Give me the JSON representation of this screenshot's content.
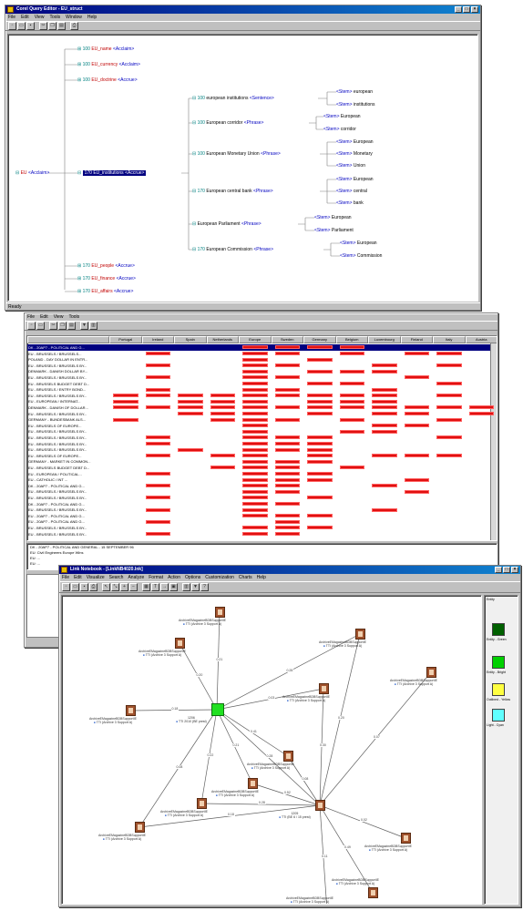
{
  "win1": {
    "title": "Corel Query Editor - EU_struct",
    "menu": [
      "File",
      "Edit",
      "View",
      "Tools",
      "Window",
      "Help"
    ],
    "status": "Ready",
    "tree": {
      "root": {
        "prefix": "EU",
        "tag": "<Acclaim>"
      },
      "top": [
        {
          "num": "100",
          "name": "EU_name",
          "tag": "<Acclaim>"
        },
        {
          "num": "100",
          "name": "EU_currency",
          "tag": "<Acclaim>"
        },
        {
          "num": "100",
          "name": "EU_doctrine",
          "tag": "<Accrue>"
        }
      ],
      "selected": {
        "num": "170",
        "name": "EU_institutions",
        "tag": "<Accrue>"
      },
      "bottom": [
        {
          "num": "170",
          "name": "EU_people",
          "tag": "<Accrue>"
        },
        {
          "num": "170",
          "name": "EU_finance",
          "tag": "<Accrue>"
        },
        {
          "num": "170",
          "name": "EU_affairs",
          "tag": "<Accrue>"
        }
      ],
      "groups": [
        {
          "num": "100",
          "text": "european institutions",
          "tag": "<Sentence>",
          "leaves": [
            "european",
            "institutions"
          ]
        },
        {
          "num": "100",
          "text": "European corridor",
          "tag": "<Phrase>",
          "leaves": [
            "European",
            "corridor"
          ]
        },
        {
          "num": "100",
          "text": "European Monetary Union",
          "tag": "<Phrase>",
          "leaves": [
            "European",
            "Monetary",
            "Union"
          ]
        },
        {
          "num": "170",
          "text": "European central bank",
          "tag": "<Phrase>",
          "leaves": [
            "European",
            "central",
            "bank"
          ]
        },
        {
          "num": "",
          "text": "European Parliament",
          "tag": "<Phrase>",
          "leaves": [
            "European",
            "Parliament"
          ]
        },
        {
          "num": "170",
          "text": "European Commission",
          "tag": "<Phrase>",
          "leaves": [
            "European",
            "Commission"
          ]
        }
      ],
      "leaf_tag": "<Stem>"
    }
  },
  "win2": {
    "menu": [
      "File",
      "Edit",
      "View",
      "Tools"
    ],
    "columns": [
      "Portugal",
      "Ireland",
      "Spain",
      "Netherlands",
      "Europe",
      "Sweden",
      "Germany",
      "Belgium",
      "Luxembourg",
      "Finland",
      "Italy",
      "Austria"
    ],
    "rows": [
      "DK - 20AP7 - POLITICAL AND G...",
      "EU - BRUSSELS / BRUSSELS...",
      "POLAND - DAY DOLLAR IN ENTR...",
      "EU - BRUSSELS / BRUSSELS BY...",
      "DENMARK - DANISH DOLLAR BY...",
      "EU - BRUSSELS / BRUSSELS BY...",
      "EU - BRUSSELS BUDGET DEBT D...",
      "EU - BRUSSELS / ENTRY BOND...",
      "EU - BRUSSELS / BRUSSELS BY...",
      "EU - EUROPEAN / INTERNAT...",
      "DENMARK - DANISH OF DOLLAR...",
      "EU - BRUSSELS / BRUSSELS BY...",
      "GERMANY - BUNDESBANK ALS...",
      "EU - BRUSSELS OF EUROPE...",
      "EU - BRUSSELS / BRUSSELS BY...",
      "EU - BRUSSELS / BRUSSELS BY...",
      "EU - BRUSSELS / BRUSSELS BY...",
      "EU - BRUSSELS / BRUSSELS BY...",
      "EU - BRUSSELS OF EUROPE...",
      "GERMANY - MARKET IN COMMON...",
      "EU - BRUSSELS BUDGET DEBT D...",
      "EU - EUROPEAN / POLITICAL...",
      "EU - CATHOLIC / INT ...",
      "DK - 20AP7 - POLITICAL AND G...",
      "EU - BRUSSELS / BRUSSELS BY...",
      "EU - BRUSSELS / BRUSSELS BY...",
      "DK - 20AP7 - POLITICAL AND G...",
      "EU - BRUSSELS / BRUSSELS BY...",
      "EU - 20AP7 - POLITICAL AND G...",
      "EU - 20AP7 - POLITICAL AND G...",
      "EU - BRUSSELS / BRUSSELS BY...",
      "EU - BRUSSELS / BRUSSELS BY..."
    ],
    "lower_lines": [
      "DK - 20AP7 - POLITICAL AND GENERAL - 15 SEPTEMBER 96",
      "EU: Civil Engineers Europe Wins",
      "EU: ...",
      "EU: ..."
    ]
  },
  "win3": {
    "title": "Link Notebook - [LinkNB4020.lnk]",
    "menu": [
      "File",
      "Edit",
      "Visualize",
      "Search",
      "Analyze",
      "Format",
      "Action",
      "Options",
      "Customization",
      "Charts",
      "Help"
    ],
    "nodes": [
      {
        "id": "n1",
        "label": "ArchiveEMagazineBDBSupportIE",
        "sub": "TTI (Archive 3 Support A)"
      },
      {
        "id": "n2",
        "label": "ArchiveEMagazineBDBSupportIE",
        "sub": "TTI (Archive 3 Support A)"
      },
      {
        "id": "n3",
        "label": "ArchiveEMagazineBDBSupportIE",
        "sub": "TTI (Archive 3 Support A)"
      },
      {
        "id": "n4",
        "label": "ArchiveEMagazineBDBSupportIE",
        "sub": "TTI (Archive 3 Support A)"
      },
      {
        "id": "n5",
        "label": "ArchiveEMagazineBDBSupportIE",
        "sub": "TTI (Archive 3 Support A)"
      },
      {
        "id": "n6",
        "label": "ArchiveEMagazineBDBSupportIE",
        "sub": "TTI (Archive 3 Support A)"
      },
      {
        "id": "n7",
        "label": "ArchiveEMagazineBDBSupportIE",
        "sub": "TTI (Archive 3 Support A)"
      },
      {
        "id": "n8",
        "label": "ArchiveEMagazineBDBSupportIE",
        "sub": "TTI (Archive 3 Support A)"
      },
      {
        "id": "n9",
        "label": "ArchiveEMagazineBDBSupportIE",
        "sub": "TTI (Archive 3 Support A)"
      },
      {
        "id": "n10",
        "label": "ArchiveEMagazineBDBSupportIE",
        "sub": "TTI (Archive 3 Support A)"
      },
      {
        "id": "n11",
        "label": "ArchiveEMagazineBDBSupportIE",
        "sub": "TTI (Archive 3 Support A)"
      },
      {
        "id": "n12",
        "label": "ArchiveEMagazineBDBSupportIE",
        "sub": "TTI (Archive 3 Support A)"
      },
      {
        "id": "n13",
        "label": "ArchiveEMagazineBDBSupportIE",
        "sub": "TTI (Archive 3 Support A)"
      },
      {
        "id": "hub1",
        "label": "1206",
        "sub": "TTI 2010 (BE prest)"
      },
      {
        "id": "hub2",
        "label": "1205",
        "sub": "TTI (BE 6 / 15 prest)"
      }
    ],
    "edge_labels": [
      "0.21",
      "0.28",
      "0.20",
      "0.03",
      "0.18",
      "0.41",
      "0.22",
      "0.08",
      "0.28",
      "0.07",
      "0.30",
      "0.08",
      "0.52",
      "0.28",
      "0.02",
      "0.49",
      "0.11",
      "0.18",
      "0.21",
      "0.20"
    ],
    "palette": [
      "Entity",
      "Entity - Green",
      "Entity - Bright",
      "Outlined - Yellow",
      "Light - Cyan"
    ],
    "palette_colors": [
      "#006000",
      "#00d000",
      "#ffff40",
      "#60ffff"
    ]
  }
}
